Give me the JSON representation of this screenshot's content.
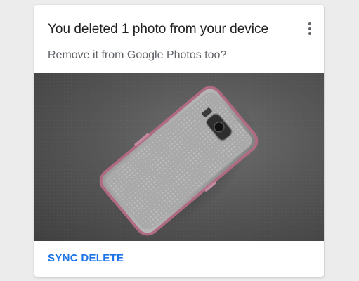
{
  "card": {
    "title": "You deleted 1 photo from your device",
    "subtitle": "Remove it from Google Photos too?",
    "menu_icon": "more-vert-icon",
    "photo_subject": "phone in clear case with pink bumper",
    "sync_delete_label": "SYNC DELETE"
  },
  "colors": {
    "accent": "#1a73e8",
    "title_text": "#212121",
    "subtitle_text": "#5f6368"
  }
}
